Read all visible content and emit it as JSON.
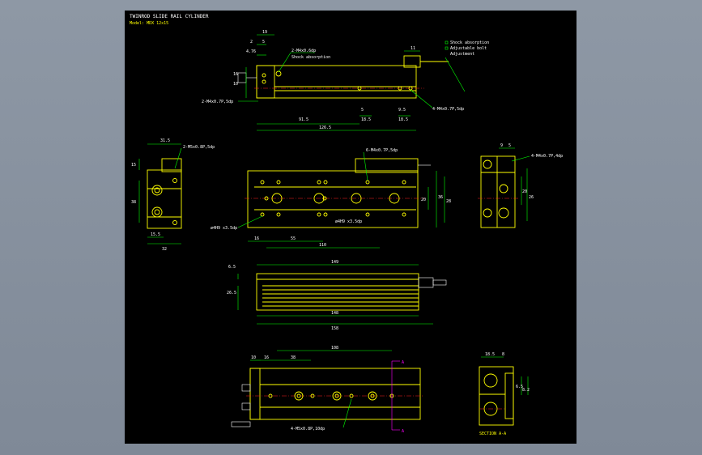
{
  "title": {
    "line1": "TWINROD SLIDE RAIL CYLINDER",
    "line2": "Model: MDX 12x15"
  },
  "labels": {
    "top_note1": "2-M4x0.6dp",
    "top_note1b": "Shock absorption",
    "top_note2": "2-M4x0.7P,5dp",
    "top_note3": "4-M4x0.7P,5dp",
    "legend1": "Shock absorption",
    "legend2": "Adjustable bolt",
    "legend3": "Adjustment",
    "left_note": "2-M5x0.8P,5dp",
    "plan_note": "6-M4x0.7P,5dp",
    "plan_hole": "ø4H9 x3.5dp",
    "plan_side": "ø4H9 x3.5dp",
    "right_note": "4-M4x0.7P,4dp",
    "bottom_note": "4-M5x0.8P,10dp",
    "section_A": "A",
    "section_label": "SECTION A-A"
  },
  "dims": {
    "top": [
      "19",
      "2",
      "5",
      "4.76",
      "11",
      "16",
      "10",
      "91.5",
      "18.5",
      "126.5",
      "18.5",
      "5",
      "9.5"
    ],
    "left": [
      "31.5",
      "15",
      "38",
      "15.5",
      "32"
    ],
    "plan": [
      "16",
      "55",
      "110",
      "20",
      "36",
      "28"
    ],
    "right": [
      "9",
      "5",
      "20",
      "26"
    ],
    "side": [
      "149",
      "148",
      "158",
      "6.5",
      "26.5"
    ],
    "bottom": [
      "108",
      "10",
      "16",
      "38",
      "18.5",
      "8",
      "6.5",
      "8.2"
    ]
  },
  "colors": {
    "background": "#8c96a3",
    "sheet": "#000000",
    "outline": "#ffff00",
    "dimension": "#00ff00",
    "text": "#ffffff",
    "centerline": "#ff2020",
    "section": "#ff00ff"
  }
}
